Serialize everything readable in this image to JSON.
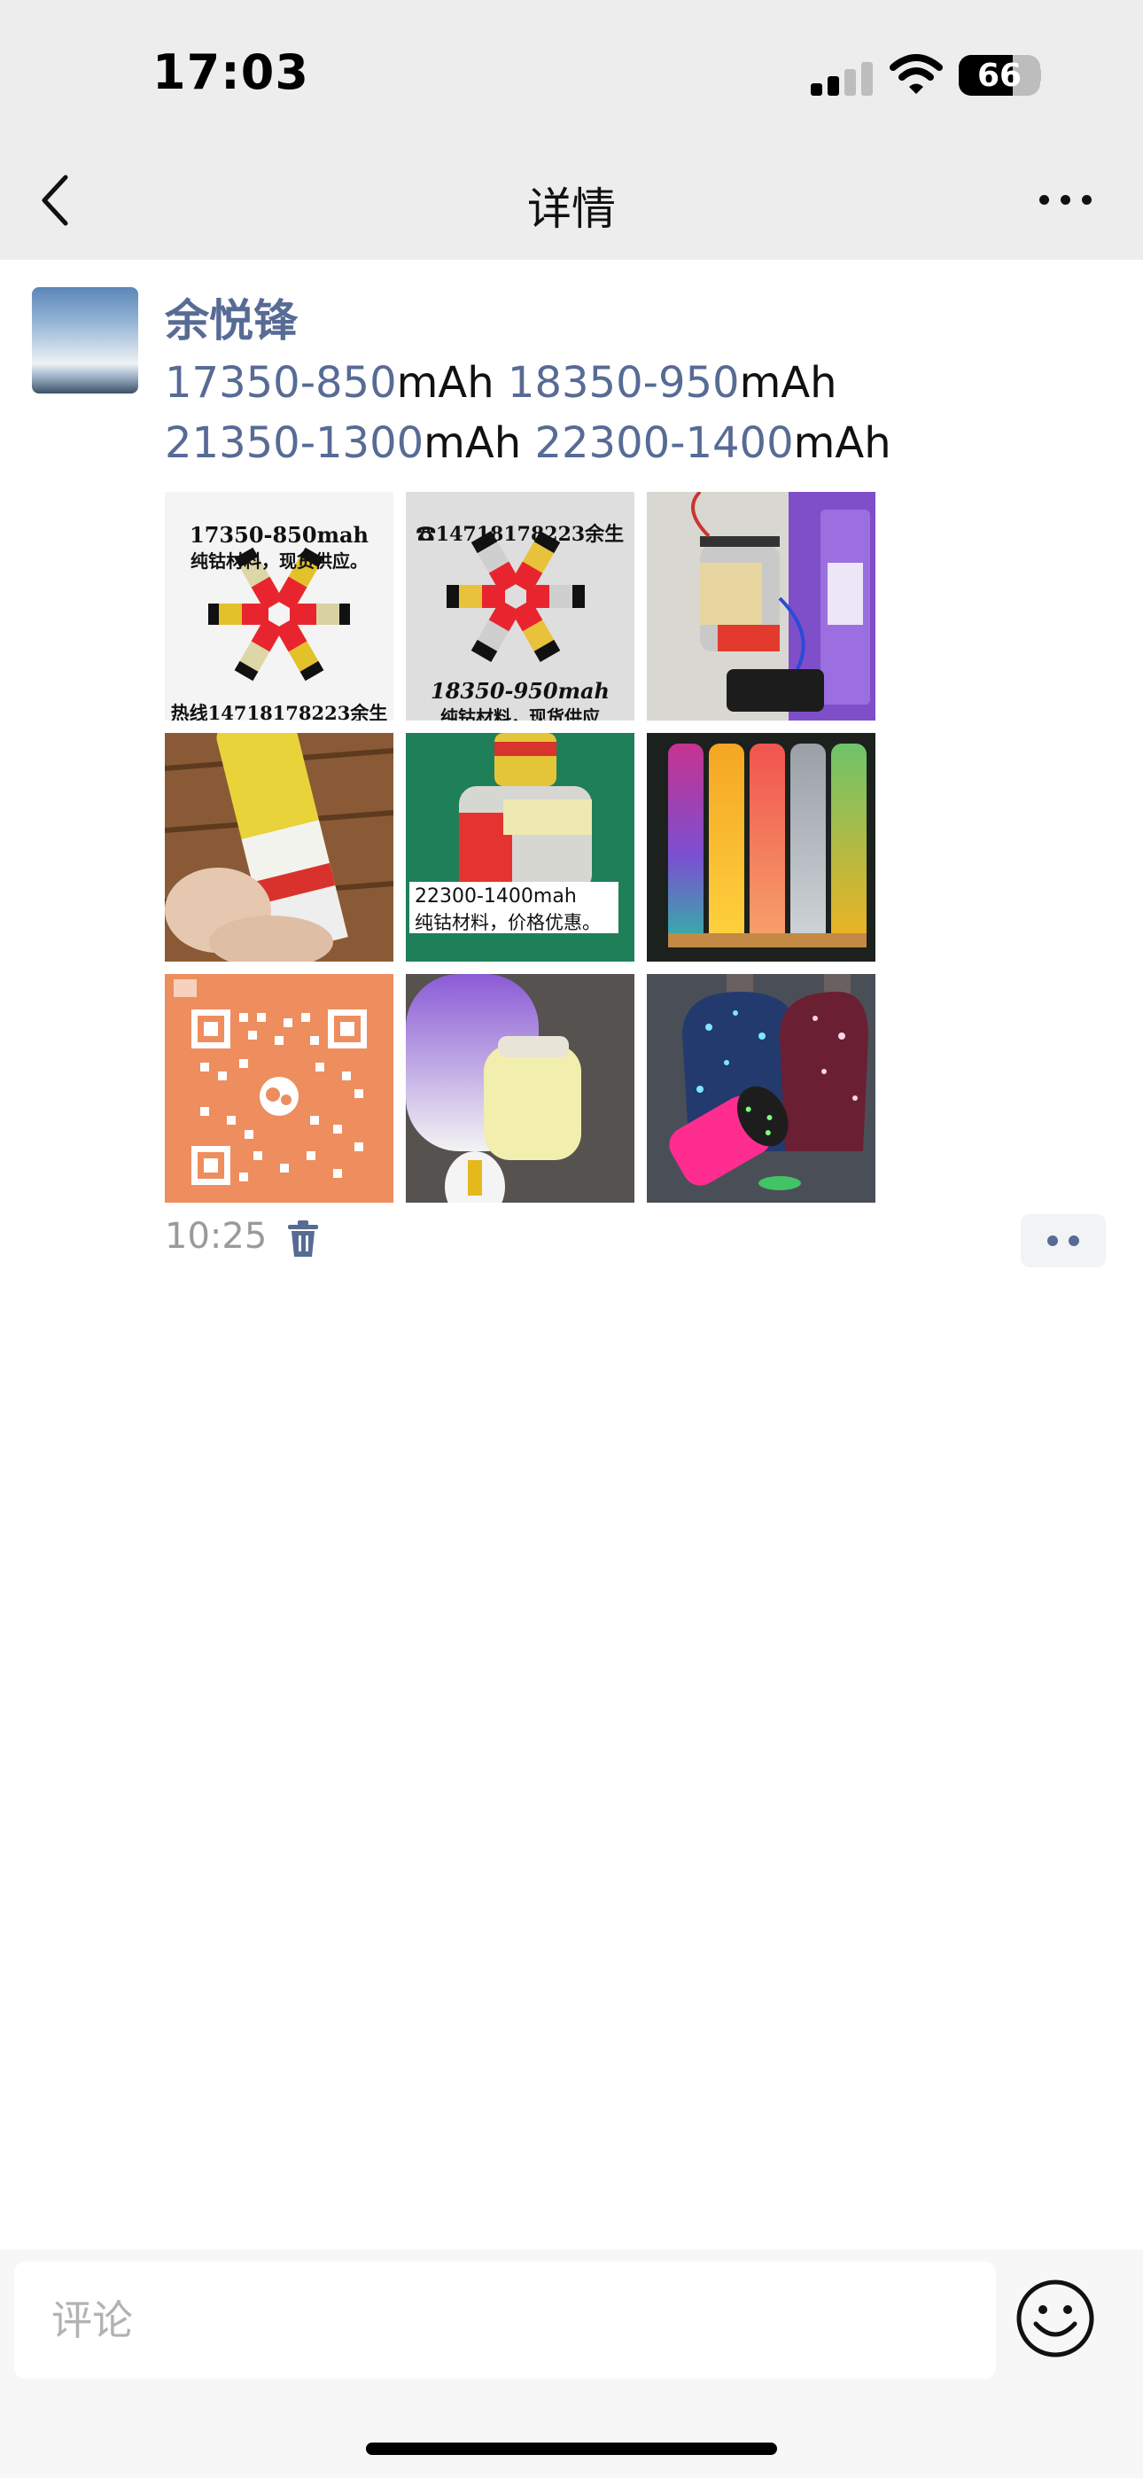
{
  "status_bar": {
    "time": "17:03",
    "battery": "66",
    "battery_level": 0.66
  },
  "nav": {
    "title": "详情",
    "back_icon": "chevron-left-icon",
    "more_icon": "ellipsis-icon"
  },
  "post": {
    "author": "余悦锋",
    "text_segments": [
      {
        "text": "17350-850",
        "link": true
      },
      {
        "text": "mAh ",
        "link": false
      },
      {
        "text": "18350-950",
        "link": true
      },
      {
        "text": "mAh",
        "link": false
      },
      {
        "text": "21350-1300",
        "link": true
      },
      {
        "text": "mAh ",
        "link": false
      },
      {
        "text": "22300-1400",
        "link": true
      },
      {
        "text": "mAh",
        "link": false
      }
    ],
    "images": [
      {
        "caption_top": "17350-850mah",
        "caption_top2": "纯钴材料，现货供应。",
        "caption_bottom": "热线14718178223余生"
      },
      {
        "caption_top": "☎14718178223余生",
        "caption_bottom": "18350-950mah",
        "caption_bottom2": "纯钴材料，现货供应"
      },
      {
        "caption_top": ""
      },
      {
        "caption_top": ""
      },
      {
        "caption_top": "22300-1400mah",
        "caption_top2": "纯钴材料，价格优惠。"
      },
      {
        "caption_top": ""
      },
      {
        "caption_top": ""
      },
      {
        "caption_top": ""
      },
      {
        "caption_top": ""
      }
    ],
    "time": "10:25"
  },
  "comment": {
    "placeholder": "评论"
  },
  "colors": {
    "link": "#576b95",
    "header_bg": "#ededed",
    "bottom_bg": "#f7f7f7"
  }
}
